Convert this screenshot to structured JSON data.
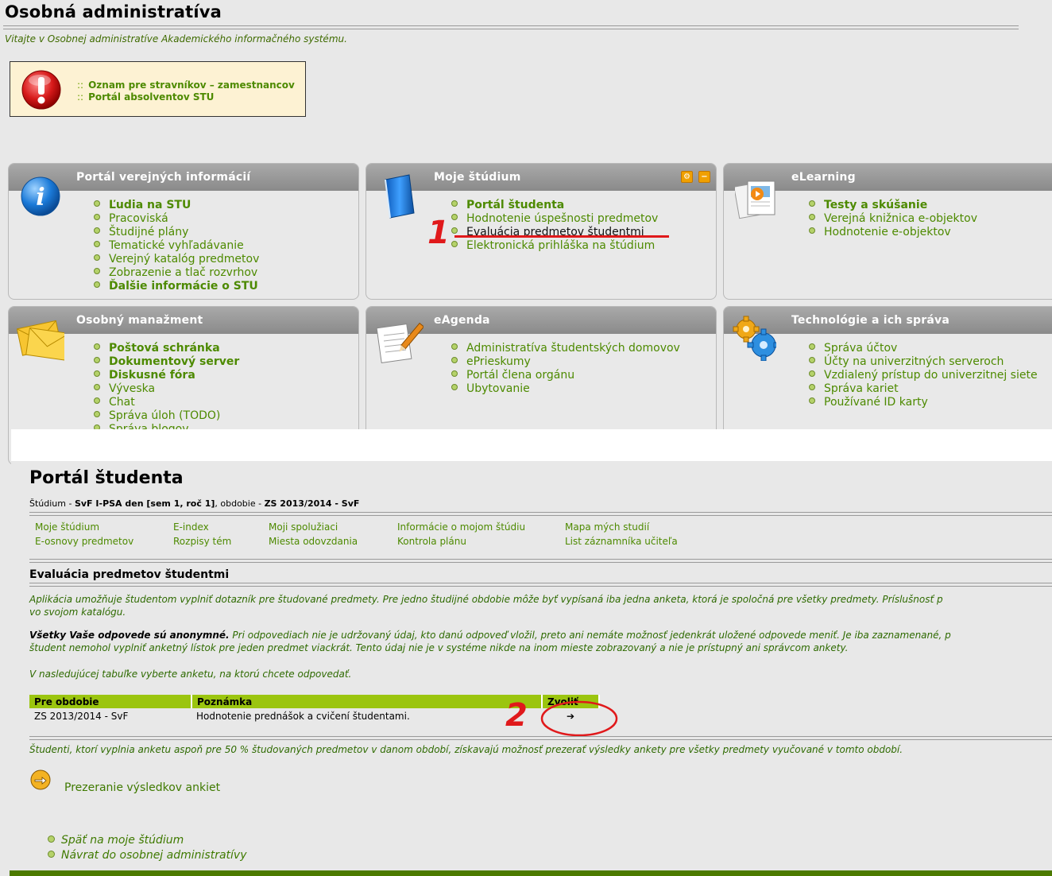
{
  "header": {
    "title": "Osobná administratíva",
    "subtitle": "Vitajte v Osobnej administratíve Akademického informačného systému."
  },
  "notice": {
    "sep": "::",
    "items": [
      "Oznam pre stravníkov – zamestnancov",
      "Portál absolventov STU"
    ]
  },
  "panels": {
    "public": {
      "title": "Portál verejných informácií",
      "icon": "info-icon",
      "items": [
        "Ľudia na STU",
        "Pracoviská",
        "Študijné plány",
        "Tematické vyhľadávanie",
        "Verejný katalóg predmetov",
        "Zobrazenie a tlač rozvrhov",
        "Ďalšie informácie o STU"
      ]
    },
    "study": {
      "title": "Moje štúdium",
      "icon": "book-icon",
      "items": [
        "Portál študenta",
        "Hodnotenie úspešnosti predmetov",
        "Evaluácia predmetov študentmi",
        "Elektronická prihláška na štúdium"
      ]
    },
    "elearning": {
      "title": "eLearning",
      "icon": "documents-icon",
      "items": [
        "Testy a skúšanie",
        "Verejná knižnica e-objektov",
        "Hodnotenie e-objektov"
      ]
    },
    "personal": {
      "title": "Osobný manažment",
      "icon": "envelope-icon",
      "items": [
        "Poštová schránka",
        "Dokumentový server",
        "Diskusné fóra",
        "Výveska",
        "Chat",
        "Správa úloh (TODO)",
        "Správa blogov"
      ]
    },
    "eagenda": {
      "title": "eAgenda",
      "icon": "notepad-pencil-icon",
      "items": [
        "Administratíva študentských domovov",
        "ePrieskumy",
        "Portál člena orgánu",
        "Ubytovanie"
      ]
    },
    "tech": {
      "title": "Technológie a ich správa",
      "icon": "gears-icon",
      "items": [
        "Správa účtov",
        "Účty na univerzitných serveroch",
        "Vzdialený prístup do univerzitnej siete",
        "Správa kariet",
        "Používané ID karty"
      ]
    }
  },
  "annotations": {
    "one": "1",
    "two": "2"
  },
  "portal": {
    "title": "Portál študenta",
    "study_label": "Štúdium - ",
    "study_value": "SvF I-PSA den [sem 1, roč 1]",
    "period_label": ", obdobie - ",
    "period_value": "ZS 2013/2014 - SvF",
    "nav": [
      "Moje štúdium",
      "E-index",
      "Moji spolužiaci",
      "Informácie o mojom štúdiu",
      "Mapa mých studií",
      "E-osnovy predmetov",
      "Rozpisy tém",
      "Miesta odovzdania",
      "Kontrola plánu",
      "List záznamníka učiteľa"
    ]
  },
  "evaluation": {
    "title": "Evaluácia predmetov študentmi",
    "intro_line1": "Aplikácia umožňuje študentom vyplniť dotazník pre študované predmety. Pre jedno študijné obdobie môže byť vypísaná iba jedna anketa, ktorá je spoločná pre všetky predmety. Príslušnosť p",
    "intro_line2": "vo svojom katalógu.",
    "anon_bold": "Všetky Vaše odpovede sú anonymné.",
    "anon_line1": " Pri odpovediach nie je udržovaný údaj, kto danú odpoveď vložil, preto ani nemáte možnosť jedenkrát uložené odpovede meniť. Je iba zaznamenané, p",
    "anon_line2": "študent nemohol vyplniť anketný lístok pre jeden predmet viackrát. Tento údaj nie je v systéme nikde na inom mieste zobrazovaný a nie je prístupný ani správcom ankety.",
    "choose_text": "V nasledujúcej tabuľke vyberte anketu, na ktorú chcete odpovedať.",
    "table": {
      "headers": [
        "Pre obdobie",
        "Poznámka",
        "Zvoliť"
      ],
      "rows": [
        [
          "ZS 2013/2014 - SvF",
          "Hodnotenie prednášok a cvičení študentami."
        ]
      ]
    },
    "footnote": "Študenti, ktorí vyplnia anketu aspoň pre 50 % študovaných predmetov v danom období, získavajú možnosť prezerať výsledky ankety pre všetky predmety vyučované v tomto období.",
    "results_link": "Prezeranie výsledkov ankiet",
    "back_links": [
      "Späť na moje štúdium",
      "Návrat do osobnej administratívy"
    ]
  }
}
